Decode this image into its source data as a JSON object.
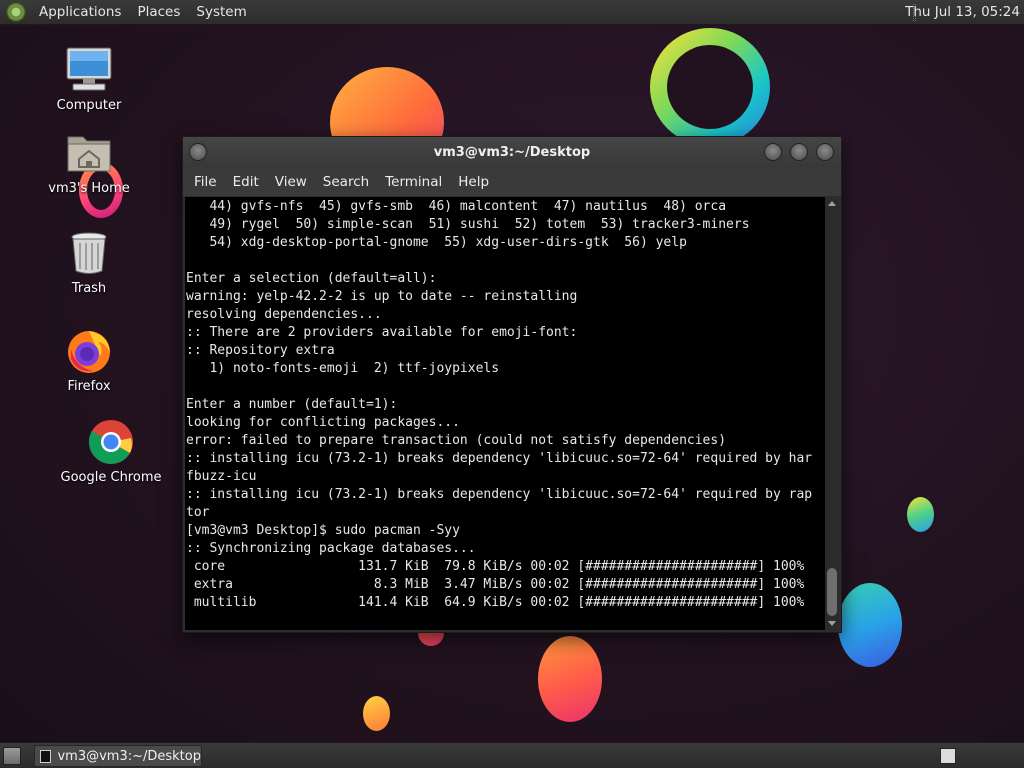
{
  "top_panel": {
    "menus": [
      "Applications",
      "Places",
      "System"
    ],
    "clock": "Thu Jul 13, 05:24"
  },
  "desktop_icons": [
    {
      "label": "Computer",
      "icon": "computer-icon"
    },
    {
      "label": "vm3's Home",
      "icon": "home-folder-icon"
    },
    {
      "label": "Trash",
      "icon": "trash-icon"
    },
    {
      "label": "Firefox",
      "icon": "firefox-icon"
    },
    {
      "label": "Google Chrome",
      "icon": "chrome-icon"
    }
  ],
  "terminal": {
    "title": "vm3@vm3:~/Desktop",
    "menus": [
      "File",
      "Edit",
      "View",
      "Search",
      "Terminal",
      "Help"
    ],
    "output": "   44) gvfs-nfs  45) gvfs-smb  46) malcontent  47) nautilus  48) orca\n   49) rygel  50) simple-scan  51) sushi  52) totem  53) tracker3-miners\n   54) xdg-desktop-portal-gnome  55) xdg-user-dirs-gtk  56) yelp\n\nEnter a selection (default=all):\nwarning: yelp-42.2-2 is up to date -- reinstalling\nresolving dependencies...\n:: There are 2 providers available for emoji-font:\n:: Repository extra\n   1) noto-fonts-emoji  2) ttf-joypixels\n\nEnter a number (default=1):\nlooking for conflicting packages...\nerror: failed to prepare transaction (could not satisfy dependencies)\n:: installing icu (73.2-1) breaks dependency 'libicuuc.so=72-64' required by har\nfbuzz-icu\n:: installing icu (73.2-1) breaks dependency 'libicuuc.so=72-64' required by rap\ntor\n[vm3@vm3 Desktop]$ sudo pacman -Syy\n:: Synchronizing package databases...\n core                 131.7 KiB  79.8 KiB/s 00:02 [######################] 100%\n extra                  8.3 MiB  3.47 MiB/s 00:02 [######################] 100%\n multilib             141.4 KiB  64.9 KiB/s 00:02 [######################] 100%"
  },
  "bottom_panel": {
    "task_label": "vm3@vm3:~/Desktop"
  },
  "colors": {
    "panel": "#2c2c2c",
    "terminal_bg": "#000000",
    "terminal_fg": "#e8e8e8",
    "desktop_bg": "#22121f"
  }
}
